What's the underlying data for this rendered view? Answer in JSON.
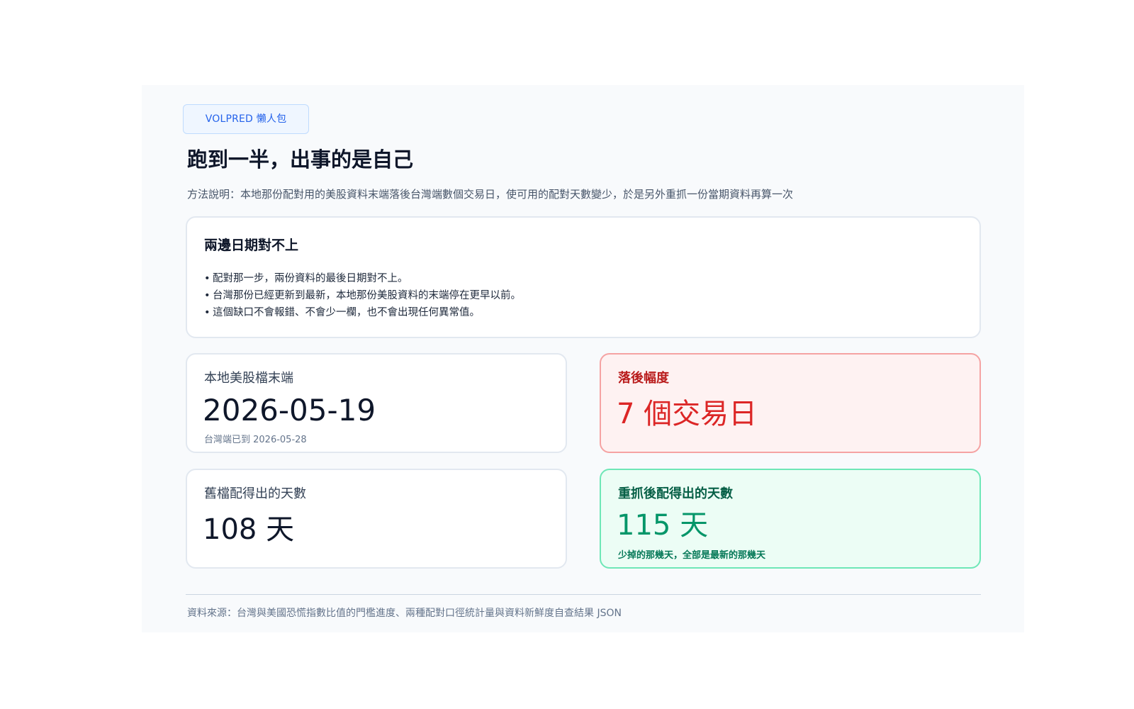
{
  "badge": "VOLPRED 懶人包",
  "title": "跑到一半，出事的是自己",
  "subtitle": "方法說明：本地那份配對用的美股資料末端落後台灣端數個交易日，使可用的配對天數變少，於是另外重抓一份當期資料再算一次",
  "summary_card": {
    "heading": "兩邊日期對不上",
    "bullet_glyph": "•",
    "bullets": [
      "配對那一步，兩份資料的最後日期對不上。",
      "台灣那份已經更新到最新，本地那份美股資料的末端停在更早以前。",
      "這個缺口不會報錯、不會少一欄，也不會出現任何異常值。"
    ]
  },
  "stats": {
    "local_end": {
      "label": "本地美股檔末端",
      "value": "2026-05-19",
      "note": "台灣端已到 2026-05-28"
    },
    "lag": {
      "label": "落後幅度",
      "value": "7 個交易日"
    },
    "old_days": {
      "label": "舊檔配得出的天數",
      "value": "108 天"
    },
    "new_days": {
      "label": "重抓後配得出的天數",
      "value": "115 天",
      "note": "少掉的那幾天，全部是最新的那幾天"
    }
  },
  "footer": "資料來源：台灣與美國恐慌指數比值的門檻進度、兩種配對口徑統計量與資料新鮮度自查結果 JSON",
  "colors": {
    "accent_blue": "#2563eb",
    "alert_red": "#dc2626",
    "success_green": "#059669"
  }
}
